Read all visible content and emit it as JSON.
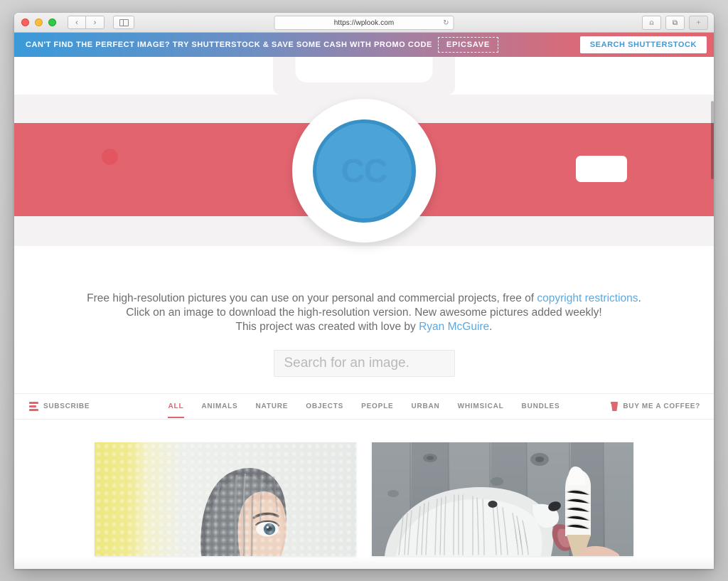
{
  "browser": {
    "url": "https://wplook.com",
    "reload_icon": "reload-icon",
    "back_icon": "‹",
    "forward_icon": "›",
    "sidebar_icon": "sidebar-icon",
    "share_icon": "⇧",
    "tabs_icon": "⧉",
    "newtab_icon": "+"
  },
  "promo": {
    "text": "CAN'T FIND THE PERFECT IMAGE? TRY SHUTTERSTOCK & SAVE SOME CASH WITH PROMO CODE",
    "code": "EPICSAVE",
    "button": "SEARCH SHUTTERSTOCK",
    "gradient_start": "#3a9ad9",
    "gradient_end": "#e2646f",
    "button_text_color": "#3d9bdc"
  },
  "hero": {
    "lens_text": "CC",
    "accent_red": "#e2646f",
    "lens_blue": "#4ba3d6",
    "lens_blue_dark": "#3790c6"
  },
  "intro": {
    "line1_part1": "Free high-resolution pictures you can use on your personal and commercial projects, free of ",
    "line1_link": "copyright restrictions",
    "line1_end": ".",
    "line2": "Click on an image to download the high-resolution version. New awesome pictures added weekly!",
    "line3_part1": "This project was created with love by ",
    "line3_link": "Ryan McGuire",
    "line3_end": "."
  },
  "search": {
    "placeholder": "Search for an image.",
    "value": ""
  },
  "nav": {
    "subscribe_label": "SUBSCRIBE",
    "coffee_label": "BUY ME A COFFEE?",
    "active_color": "#e2646f",
    "categories": [
      {
        "label": "ALL",
        "active": true
      },
      {
        "label": "ANIMALS",
        "active": false
      },
      {
        "label": "NATURE",
        "active": false
      },
      {
        "label": "OBJECTS",
        "active": false
      },
      {
        "label": "PEOPLE",
        "active": false
      },
      {
        "label": "URBAN",
        "active": false
      },
      {
        "label": "WHIMSICAL",
        "active": false
      },
      {
        "label": "BUNDLES",
        "active": false
      }
    ]
  },
  "gallery": {
    "items": [
      {
        "alt": "Woman peeking through bubble wrap with yellow band on left"
      },
      {
        "alt": "Shaggy white dog licking a soft-serve ice cream cone against grey wooden fence"
      }
    ]
  }
}
